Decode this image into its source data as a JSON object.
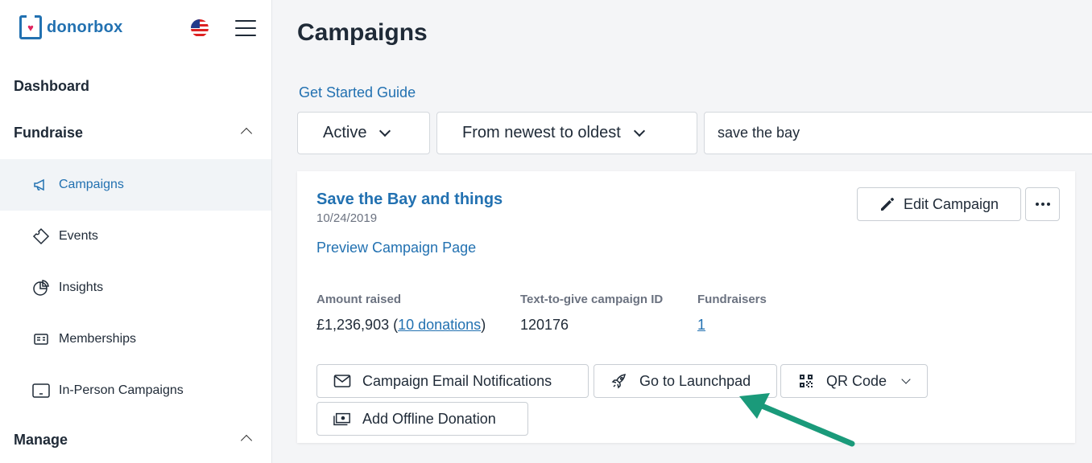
{
  "brand": {
    "name": "donorbox"
  },
  "sidebar": {
    "sections": [
      {
        "label": "Dashboard"
      },
      {
        "label": "Fundraise"
      },
      {
        "label": "Manage"
      }
    ],
    "items": [
      {
        "label": "Campaigns",
        "icon": "megaphone-icon"
      },
      {
        "label": "Events",
        "icon": "ticket-icon"
      },
      {
        "label": "Insights",
        "icon": "pie-chart-icon"
      },
      {
        "label": "Memberships",
        "icon": "membership-card-icon"
      },
      {
        "label": "In-Person Campaigns",
        "icon": "tablet-icon"
      }
    ]
  },
  "main": {
    "title": "Campaigns",
    "guide_link": "Get Started Guide",
    "filters": {
      "status": "Active",
      "sort": "From newest to oldest",
      "search_value": "save the bay"
    },
    "campaign": {
      "title": "Save the Bay and things",
      "date": "10/24/2019",
      "preview_link": "Preview Campaign Page",
      "edit_label": "Edit Campaign",
      "stats": {
        "amount_label": "Amount raised",
        "amount_value": "£1,236,903",
        "donations_link": "10 donations",
        "text_id_label": "Text-to-give campaign ID",
        "text_id_value": "120176",
        "fundraisers_label": "Fundraisers",
        "fundraisers_value": "1"
      },
      "actions": {
        "email": "Campaign Email Notifications",
        "launchpad": "Go to Launchpad",
        "qr": "QR Code",
        "offline": "Add Offline Donation"
      }
    }
  },
  "colors": {
    "accent": "#2271b1",
    "arrow": "#1a9a7a"
  }
}
